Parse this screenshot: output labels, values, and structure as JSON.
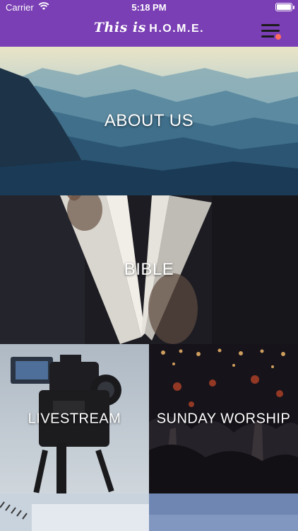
{
  "status_bar": {
    "carrier": "Carrier",
    "time": "5:18 PM"
  },
  "header": {
    "logo_script": "This is",
    "logo_brand": "H.O.M.E.",
    "menu_icon": "hamburger-menu-icon",
    "notification_dot_color": "#ff6b5e"
  },
  "colors": {
    "header_bg": "#7a3fb4"
  },
  "tiles": [
    {
      "label": "ABOUT US",
      "image": "misty-mountains"
    },
    {
      "label": "BIBLE",
      "image": "open-book"
    },
    {
      "label": "LIVESTREAM",
      "image": "video-camera"
    },
    {
      "label": "SUNDAY WORSHIP",
      "image": "concert-crowd"
    }
  ]
}
